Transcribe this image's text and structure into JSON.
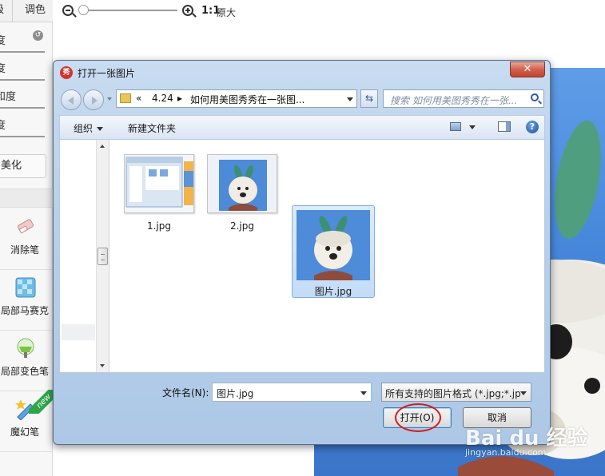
{
  "app": {
    "tabs": [
      {
        "label": "级"
      },
      {
        "label": "调色"
      }
    ],
    "sliders": [
      {
        "label": "度"
      },
      {
        "label": "度"
      },
      {
        "label": "和度"
      },
      {
        "label": "度"
      }
    ],
    "beautify_label": "美化",
    "tools": [
      {
        "label": "消除笔",
        "icon": "eraser-icon"
      },
      {
        "label": "局部马赛克",
        "icon": "mosaic-icon"
      },
      {
        "label": "局部变色笔",
        "icon": "color-brush-icon"
      },
      {
        "label": "魔幻笔",
        "icon": "magic-pen-icon"
      }
    ],
    "new_badge": "new",
    "zoom": {
      "ratio_label": "1:1",
      "original_label": "原大"
    }
  },
  "dialog": {
    "title": "打开一张图片",
    "close_label": "✕",
    "address": {
      "chevron": "«",
      "crumbs": [
        "4.24",
        "如何用美图秀秀在一张图..."
      ]
    },
    "search_placeholder": "搜索 如何用美图秀秀在一张...",
    "toolbar": {
      "organize_label": "组织",
      "new_folder_label": "新建文件夹"
    },
    "files": [
      {
        "name": "1.jpg",
        "selected": false
      },
      {
        "name": "2.jpg",
        "selected": false
      },
      {
        "name": "图片.jpg",
        "selected": true
      }
    ],
    "filename_label": "文件名(N):",
    "filename_value": "图片.jpg",
    "filetype_value": "所有支持的图片格式 (*.jpg;*.jp",
    "open_label": "打开(O)",
    "cancel_label": "取消"
  },
  "watermark": {
    "logo": "Bai du 经验",
    "url": "jingyan.baidu.com"
  },
  "colors": {
    "accent_red": "#d8191e",
    "sky_blue": "#4a88dd",
    "dialog_frame": "#b8d0eb"
  }
}
